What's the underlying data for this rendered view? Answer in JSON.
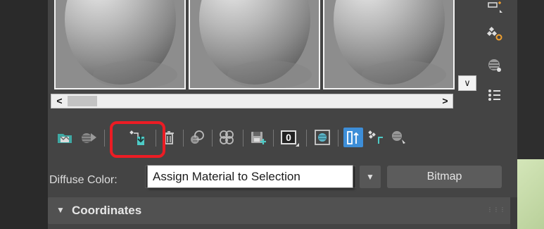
{
  "editor": {
    "sample_slots": [
      {
        "name": "sample-slot-1"
      },
      {
        "name": "sample-slot-2"
      },
      {
        "name": "sample-slot-3"
      }
    ],
    "scroll": {
      "left_arrow": "<",
      "right_arrow": ">"
    },
    "slot_dropdown_glyph": "∨",
    "side_icons": [
      "sample-type-icon",
      "backlight-icon",
      "background-icon",
      "options-icon"
    ],
    "toolbar": [
      "get-material-icon",
      "put-to-scene-icon",
      "assign-material-to-selection-icon",
      "reset-map-icon",
      "make-material-copy-icon",
      "make-unique-icon",
      "put-to-library-icon",
      "material-id-channel-icon",
      "show-shaded-material-icon",
      "show-end-result-icon",
      "go-to-parent-icon",
      "go-forward-to-sibling-icon"
    ],
    "material_id_value": "0",
    "tooltip": "Assign Material to Selection",
    "diffuse": {
      "label": "Diffuse Color:",
      "button_label": "Bitmap",
      "dropdown_glyph": "▼"
    },
    "rollout": {
      "title": "Coordinates",
      "arrow": "▼",
      "grip": "⋮⋮⋮"
    }
  },
  "colors": {
    "panel_bg": "#444444",
    "highlight": "#ec1c24",
    "active_tool": "#3d8ed8",
    "accent_teal": "#4ecbc6"
  }
}
